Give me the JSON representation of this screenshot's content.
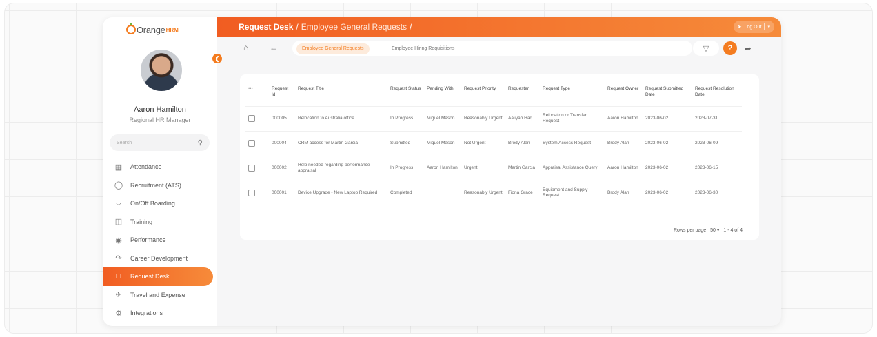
{
  "brand": {
    "name": "Orange",
    "suffix": "HRM"
  },
  "user": {
    "name": "Aaron Hamilton",
    "role": "Regional HR Manager"
  },
  "search": {
    "placeholder": "Search"
  },
  "sidebar": {
    "items": [
      {
        "label": "Attendance",
        "icon": "calendar-icon"
      },
      {
        "label": "Recruitment (ATS)",
        "icon": "chat-bubble-icon"
      },
      {
        "label": "On/Off Boarding",
        "icon": "handshake-icon"
      },
      {
        "label": "Training",
        "icon": "presentation-icon"
      },
      {
        "label": "Performance",
        "icon": "award-icon"
      },
      {
        "label": "Career Development",
        "icon": "career-ladder-icon"
      },
      {
        "label": "Request Desk",
        "icon": "request-tray-icon",
        "active": true
      },
      {
        "label": "Travel and Expense",
        "icon": "plane-icon"
      },
      {
        "label": "Integrations",
        "icon": "gear-icon"
      }
    ]
  },
  "header": {
    "module": "Request Desk",
    "separator": "/",
    "section": "Employee General Requests",
    "trailing": "/",
    "logout_label": "Log Out"
  },
  "toolbar": {
    "tabs": [
      "Employee General Requests",
      "Employee Hiring Requisitions"
    ],
    "help_label": "?"
  },
  "table": {
    "more_label": "•••",
    "columns": [
      "Request Id",
      "Request Title",
      "Request Status",
      "Pending With",
      "Request Priority",
      "Requester",
      "Request Type",
      "Request Owner",
      "Request Submitted Date",
      "Request Resolution Date"
    ],
    "rows": [
      [
        "000005",
        "Relocation to Australia office",
        "In Progress",
        "Miguel Mason",
        "Reasonably Urgent",
        "Aaliyah Haq",
        "Relocation or Transfer Request",
        "Aaron Hamilton",
        "2023-06-02",
        "2023-07-31"
      ],
      [
        "000004",
        "CRM access for Martin Garcia",
        "Submitted",
        "Miguel Mason",
        "Not Urgent",
        "Brody Alan",
        "System Access Request",
        "Brody Alan",
        "2023-06-02",
        "2023-06-09"
      ],
      [
        "000002",
        "Help needed regarding performance appraisal",
        "In Progress",
        "Aaron Hamilton",
        "Urgent",
        "Martin Garcia",
        "Appraisal Assistance Query",
        "Aaron Hamilton",
        "2023-06-02",
        "2023-06-15"
      ],
      [
        "000001",
        "Device Upgrade - New Laptop Required",
        "Completed",
        "",
        "Reasonably Urgent",
        "Fiona Grace",
        "Equipment and Supply Request",
        "Brody Alan",
        "2023-06-02",
        "2023-06-30"
      ]
    ]
  },
  "pagination": {
    "rows_per_page_label": "Rows per page",
    "rows_per_page": "50",
    "range": "1 - 4 of 4"
  },
  "colors": {
    "accent": "#f47c20",
    "accent_dark": "#f15d22"
  }
}
